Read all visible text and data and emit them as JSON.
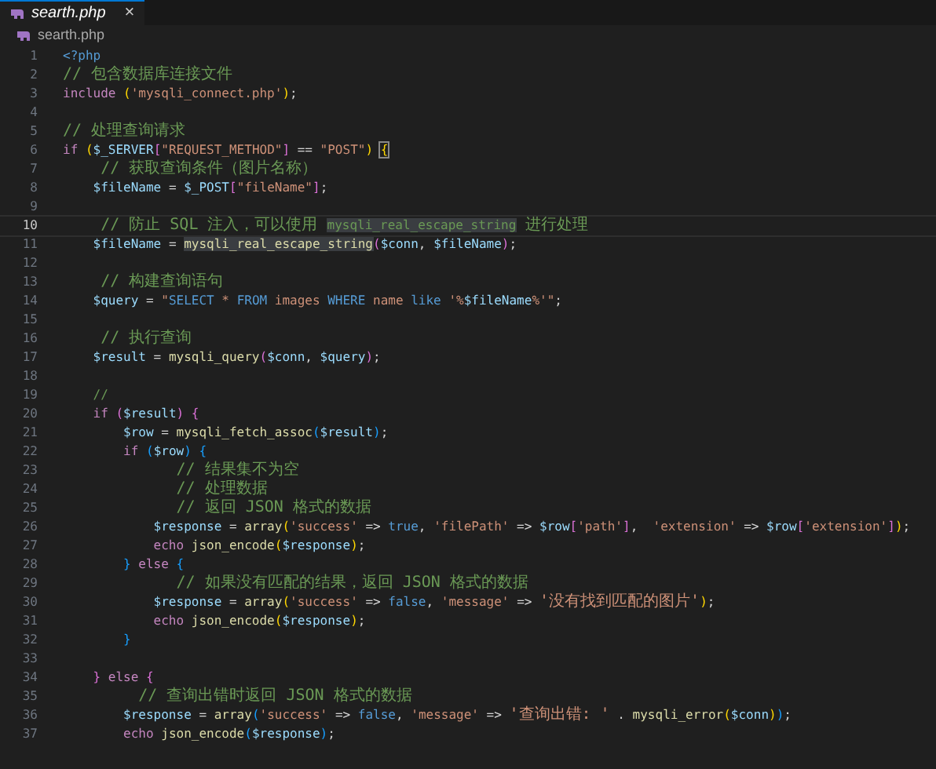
{
  "tab": {
    "label": "searth.php",
    "selected": true,
    "close": "×"
  },
  "breadcrumb": {
    "label": "searth.php"
  },
  "lines": [
    {
      "number": "1",
      "active": false,
      "tokens": [
        {
          "kind": "b",
          "t": "<?php"
        }
      ]
    },
    {
      "number": "2",
      "active": false,
      "tokens": [
        {
          "kind": "c",
          "t": "// 包含数据库连接文件"
        }
      ]
    },
    {
      "number": "3",
      "active": false,
      "tokens": [
        {
          "kind": "kw",
          "t": "include "
        },
        {
          "kind": "y",
          "t": "("
        },
        {
          "kind": "s",
          "t": "'mysqli_connect.php'"
        },
        {
          "kind": "y",
          "t": ")"
        },
        {
          "kind": "p",
          "t": ";"
        }
      ]
    },
    {
      "number": "4",
      "active": false
    },
    {
      "number": "5",
      "active": false,
      "tokens": [
        {
          "kind": "c",
          "t": "// 处理查询请求"
        }
      ]
    },
    {
      "number": "6",
      "active": false,
      "tokens": [
        {
          "kind": "kw",
          "t": "if "
        },
        {
          "kind": "y",
          "t": "("
        },
        {
          "kind": "v",
          "t": "$_SERVER"
        },
        {
          "kind": "m",
          "t": "["
        },
        {
          "kind": "s",
          "t": "\"REQUEST_METHOD\""
        },
        {
          "kind": "m",
          "t": "]"
        },
        {
          "kind": "p",
          "t": " == "
        },
        {
          "kind": "s",
          "t": "\"POST\""
        },
        {
          "kind": "y",
          "t": ") "
        },
        {
          "kind": "yb",
          "t": "{"
        }
      ]
    },
    {
      "number": "7",
      "active": false,
      "tokens": [
        {
          "kind": "c",
          "t": "    // 获取查询条件（图片名称）"
        }
      ]
    },
    {
      "number": "8",
      "active": false,
      "tokens": [
        {
          "kind": "v",
          "t": "    $fileName"
        },
        {
          "kind": "p",
          "t": " = "
        },
        {
          "kind": "v",
          "t": "$_POST"
        },
        {
          "kind": "m",
          "t": "["
        },
        {
          "kind": "s",
          "t": "\"fileName\""
        },
        {
          "kind": "m",
          "t": "]"
        },
        {
          "kind": "p",
          "t": ";"
        }
      ]
    },
    {
      "number": "9",
      "active": false
    },
    {
      "number": "10",
      "active": true,
      "tokens": [
        {
          "kind": "c",
          "t": "    // 防止 SQL 注入，可以使用 "
        },
        {
          "kind": "hc",
          "t": "mysqli_real_escape_string"
        },
        {
          "kind": "c",
          "t": " 进行处理"
        }
      ]
    },
    {
      "number": "11",
      "active": false,
      "tokens": [
        {
          "kind": "v",
          "t": "    $fileName"
        },
        {
          "kind": "p",
          "t": " = "
        },
        {
          "kind": "hf",
          "t": "mysqli_real_escape_string"
        },
        {
          "kind": "m",
          "t": "("
        },
        {
          "kind": "v",
          "t": "$conn"
        },
        {
          "kind": "p",
          "t": ", "
        },
        {
          "kind": "v",
          "t": "$fileName"
        },
        {
          "kind": "m",
          "t": ")"
        },
        {
          "kind": "p",
          "t": ";"
        }
      ]
    },
    {
      "number": "12",
      "active": false
    },
    {
      "number": "13",
      "active": false,
      "tokens": [
        {
          "kind": "c",
          "t": "    // 构建查询语句"
        }
      ]
    },
    {
      "number": "14",
      "active": false,
      "tokens": [
        {
          "kind": "v",
          "t": "    $query"
        },
        {
          "kind": "p",
          "t": " = "
        },
        {
          "kind": "s",
          "t": "\""
        },
        {
          "kind": "b",
          "t": "SELECT"
        },
        {
          "kind": "s",
          "t": " * "
        },
        {
          "kind": "b",
          "t": "FROM"
        },
        {
          "kind": "s",
          "t": " images "
        },
        {
          "kind": "b",
          "t": "WHERE"
        },
        {
          "kind": "s",
          "t": " name "
        },
        {
          "kind": "b",
          "t": "like"
        },
        {
          "kind": "s",
          "t": " '%"
        },
        {
          "kind": "v",
          "t": "$fileName"
        },
        {
          "kind": "s",
          "t": "%'\""
        },
        {
          "kind": "p",
          "t": ";"
        }
      ]
    },
    {
      "number": "15",
      "active": false
    },
    {
      "number": "16",
      "active": false,
      "tokens": [
        {
          "kind": "c",
          "t": "    // 执行查询"
        }
      ]
    },
    {
      "number": "17",
      "active": false,
      "tokens": [
        {
          "kind": "v",
          "t": "    $result"
        },
        {
          "kind": "p",
          "t": " = "
        },
        {
          "kind": "f",
          "t": "mysqli_query"
        },
        {
          "kind": "m",
          "t": "("
        },
        {
          "kind": "v",
          "t": "$conn"
        },
        {
          "kind": "p",
          "t": ", "
        },
        {
          "kind": "v",
          "t": "$query"
        },
        {
          "kind": "m",
          "t": ")"
        },
        {
          "kind": "p",
          "t": ";"
        }
      ]
    },
    {
      "number": "18",
      "active": false
    },
    {
      "number": "19",
      "active": false,
      "tokens": [
        {
          "kind": "c",
          "t": "    //"
        }
      ]
    },
    {
      "number": "20",
      "active": false,
      "tokens": [
        {
          "kind": "kw",
          "t": "    if "
        },
        {
          "kind": "m",
          "t": "("
        },
        {
          "kind": "v",
          "t": "$result"
        },
        {
          "kind": "m",
          "t": ") {"
        }
      ]
    },
    {
      "number": "21",
      "active": false,
      "tokens": [
        {
          "kind": "v",
          "t": "        $row"
        },
        {
          "kind": "p",
          "t": " = "
        },
        {
          "kind": "f",
          "t": "mysqli_fetch_assoc"
        },
        {
          "kind": "bl",
          "t": "("
        },
        {
          "kind": "v",
          "t": "$result"
        },
        {
          "kind": "bl",
          "t": ")"
        },
        {
          "kind": "p",
          "t": ";"
        }
      ]
    },
    {
      "number": "22",
      "active": false,
      "tokens": [
        {
          "kind": "kw",
          "t": "        if "
        },
        {
          "kind": "bl",
          "t": "("
        },
        {
          "kind": "v",
          "t": "$row"
        },
        {
          "kind": "bl",
          "t": ") {"
        }
      ]
    },
    {
      "number": "23",
      "active": false,
      "tokens": [
        {
          "kind": "c",
          "t": "            // 结果集不为空"
        }
      ]
    },
    {
      "number": "24",
      "active": false,
      "tokens": [
        {
          "kind": "c",
          "t": "            // 处理数据"
        }
      ]
    },
    {
      "number": "25",
      "active": false,
      "tokens": [
        {
          "kind": "c",
          "t": "            // 返回 JSON 格式的数据"
        }
      ]
    },
    {
      "number": "26",
      "active": false,
      "tokens": [
        {
          "kind": "v",
          "t": "            $response"
        },
        {
          "kind": "p",
          "t": " = "
        },
        {
          "kind": "f",
          "t": "array"
        },
        {
          "kind": "y",
          "t": "("
        },
        {
          "kind": "s",
          "t": "'success'"
        },
        {
          "kind": "p",
          "t": " => "
        },
        {
          "kind": "b",
          "t": "true"
        },
        {
          "kind": "p",
          "t": ", "
        },
        {
          "kind": "s",
          "t": "'filePath'"
        },
        {
          "kind": "p",
          "t": " => "
        },
        {
          "kind": "v",
          "t": "$row"
        },
        {
          "kind": "m",
          "t": "["
        },
        {
          "kind": "s",
          "t": "'path'"
        },
        {
          "kind": "m",
          "t": "]"
        },
        {
          "kind": "p",
          "t": ",  "
        },
        {
          "kind": "s",
          "t": "'extension'"
        },
        {
          "kind": "p",
          "t": " => "
        },
        {
          "kind": "v",
          "t": "$row"
        },
        {
          "kind": "m",
          "t": "["
        },
        {
          "kind": "s",
          "t": "'extension'"
        },
        {
          "kind": "m",
          "t": "]"
        },
        {
          "kind": "y",
          "t": ")"
        },
        {
          "kind": "p",
          "t": ";"
        }
      ]
    },
    {
      "number": "27",
      "active": false,
      "tokens": [
        {
          "kind": "kw",
          "t": "            echo "
        },
        {
          "kind": "f",
          "t": "json_encode"
        },
        {
          "kind": "y",
          "t": "("
        },
        {
          "kind": "v",
          "t": "$response"
        },
        {
          "kind": "y",
          "t": ")"
        },
        {
          "kind": "p",
          "t": ";"
        }
      ]
    },
    {
      "number": "28",
      "active": false,
      "tokens": [
        {
          "kind": "bl",
          "t": "        } "
        },
        {
          "kind": "kw",
          "t": "else "
        },
        {
          "kind": "bl",
          "t": "{"
        }
      ]
    },
    {
      "number": "29",
      "active": false,
      "tokens": [
        {
          "kind": "c",
          "t": "            // 如果没有匹配的结果，返回 JSON 格式的数据"
        }
      ]
    },
    {
      "number": "30",
      "active": false,
      "tokens": [
        {
          "kind": "v",
          "t": "            $response"
        },
        {
          "kind": "p",
          "t": " = "
        },
        {
          "kind": "f",
          "t": "array"
        },
        {
          "kind": "y",
          "t": "("
        },
        {
          "kind": "s",
          "t": "'success'"
        },
        {
          "kind": "p",
          "t": " => "
        },
        {
          "kind": "b",
          "t": "false"
        },
        {
          "kind": "p",
          "t": ", "
        },
        {
          "kind": "s",
          "t": "'message'"
        },
        {
          "kind": "p",
          "t": " => "
        },
        {
          "kind": "s",
          "t": "'没有找到匹配的图片'"
        },
        {
          "kind": "y",
          "t": ")"
        },
        {
          "kind": "p",
          "t": ";"
        }
      ]
    },
    {
      "number": "31",
      "active": false,
      "tokens": [
        {
          "kind": "kw",
          "t": "            echo "
        },
        {
          "kind": "f",
          "t": "json_encode"
        },
        {
          "kind": "y",
          "t": "("
        },
        {
          "kind": "v",
          "t": "$response"
        },
        {
          "kind": "y",
          "t": ")"
        },
        {
          "kind": "p",
          "t": ";"
        }
      ]
    },
    {
      "number": "32",
      "active": false,
      "tokens": [
        {
          "kind": "bl",
          "t": "        }"
        }
      ]
    },
    {
      "number": "33",
      "active": false
    },
    {
      "number": "34",
      "active": false,
      "tokens": [
        {
          "kind": "m",
          "t": "    } "
        },
        {
          "kind": "kw",
          "t": "else "
        },
        {
          "kind": "m",
          "t": "{"
        }
      ]
    },
    {
      "number": "35",
      "active": false,
      "tokens": [
        {
          "kind": "c",
          "t": "        // 查询出错时返回 JSON 格式的数据"
        }
      ]
    },
    {
      "number": "36",
      "active": false,
      "tokens": [
        {
          "kind": "v",
          "t": "        $response"
        },
        {
          "kind": "p",
          "t": " = "
        },
        {
          "kind": "f",
          "t": "array"
        },
        {
          "kind": "bl",
          "t": "("
        },
        {
          "kind": "s",
          "t": "'success'"
        },
        {
          "kind": "p",
          "t": " => "
        },
        {
          "kind": "b",
          "t": "false"
        },
        {
          "kind": "p",
          "t": ", "
        },
        {
          "kind": "s",
          "t": "'message'"
        },
        {
          "kind": "p",
          "t": " => "
        },
        {
          "kind": "s",
          "t": "'查询出错: '"
        },
        {
          "kind": "p",
          "t": " . "
        },
        {
          "kind": "f",
          "t": "mysqli_error"
        },
        {
          "kind": "y",
          "t": "("
        },
        {
          "kind": "v",
          "t": "$conn"
        },
        {
          "kind": "y",
          "t": ")"
        },
        {
          "kind": "bl",
          "t": ")"
        },
        {
          "kind": "p",
          "t": ";"
        }
      ]
    },
    {
      "number": "37",
      "active": false,
      "tokens": [
        {
          "kind": "kw",
          "t": "        echo "
        },
        {
          "kind": "f",
          "t": "json_encode"
        },
        {
          "kind": "bl",
          "t": "("
        },
        {
          "kind": "v",
          "t": "$response"
        },
        {
          "kind": "bl",
          "t": ")"
        },
        {
          "kind": "p",
          "t": ";"
        }
      ]
    }
  ]
}
